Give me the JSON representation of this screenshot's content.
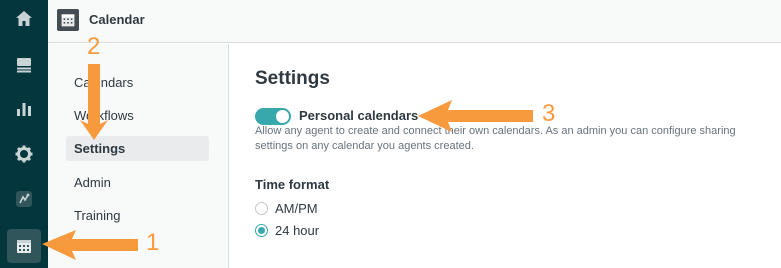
{
  "rail": {
    "items": [
      {
        "icon": "home-icon"
      },
      {
        "icon": "views-icon"
      },
      {
        "icon": "reporting-icon"
      },
      {
        "icon": "admin-gear-icon"
      },
      {
        "icon": "app-icon"
      },
      {
        "icon": "calendar-icon"
      }
    ]
  },
  "header": {
    "title": "Calendar",
    "icon": "calendar-icon"
  },
  "subnav": {
    "items": [
      {
        "label": "Calendars"
      },
      {
        "label": "Workflows"
      },
      {
        "label": "Settings",
        "active": true
      },
      {
        "label": "Admin"
      },
      {
        "label": "Training"
      }
    ]
  },
  "main": {
    "title": "Settings",
    "personal_calendars": {
      "label": "Personal calendars",
      "enabled": true,
      "help": "Allow any agent to create and connect their own calendars. As an admin you can configure sharing settings on any calendar you agents created."
    },
    "time_format": {
      "label": "Time format",
      "options": [
        {
          "label": "AM/PM",
          "selected": false
        },
        {
          "label": "24 hour",
          "selected": true
        }
      ]
    }
  },
  "annotations": {
    "color": "#f79a3e",
    "callouts": [
      "1",
      "2",
      "3"
    ]
  },
  "colors": {
    "rail_bg": "#03363d",
    "accent": "#38a8ad",
    "annotation": "#f79a3e"
  }
}
